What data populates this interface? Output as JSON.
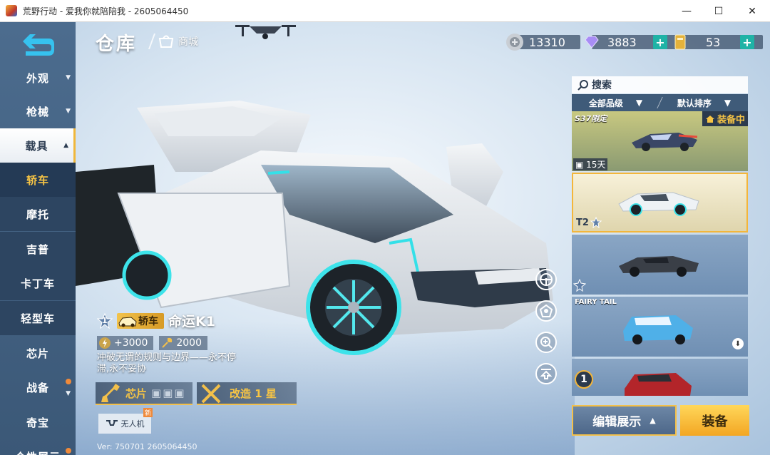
{
  "window": {
    "title": "荒野行动 - 爱我你就陪陪我 - 2605064450",
    "min_icon": "—",
    "max_icon": "☐",
    "close_icon": "✕"
  },
  "header": {
    "title": "仓库",
    "shop_label": "商城"
  },
  "currency": {
    "silver": "13310",
    "diamond": "3883",
    "coupon": "53",
    "plus": "+"
  },
  "nav": {
    "items": [
      {
        "label": "外观",
        "caret": "▼"
      },
      {
        "label": "枪械",
        "caret": "▼"
      },
      {
        "label": "载具",
        "caret": "▲"
      },
      {
        "label": "轿车"
      },
      {
        "label": "摩托"
      },
      {
        "label": "吉普"
      },
      {
        "label": "卡丁车"
      },
      {
        "label": "轻型车"
      },
      {
        "label": "芯片"
      },
      {
        "label": "战备",
        "caret": "▼"
      },
      {
        "label": "奇宝"
      },
      {
        "label": "个性展示"
      }
    ]
  },
  "list": {
    "search_label": "搜索",
    "filter_quality": "全部品级",
    "filter_sort": "默认排序",
    "caret": "▼",
    "cards": [
      {
        "tag": "S37限定",
        "equip_label": "装备中",
        "days": "15天"
      },
      {
        "tier": "T2"
      },
      {},
      {
        "tag": "FAIRY TAIL"
      },
      {
        "number": "1"
      }
    ]
  },
  "vehicle": {
    "rank": "1",
    "type": "轿车",
    "name": "命运K1",
    "stat_a": "+3000",
    "stat_b": "2000",
    "desc": "冲破无谓的规则与边界——永不停滞,永不妥协",
    "chip_label": "芯片",
    "mod_label": "改造 1 星",
    "drone_label": "无人机",
    "new_label": "新"
  },
  "buttons": {
    "edit_label": "编辑展示",
    "edit_caret": "▲",
    "equip_label": "装备"
  },
  "version": "Ver: 750701 2605064450"
}
